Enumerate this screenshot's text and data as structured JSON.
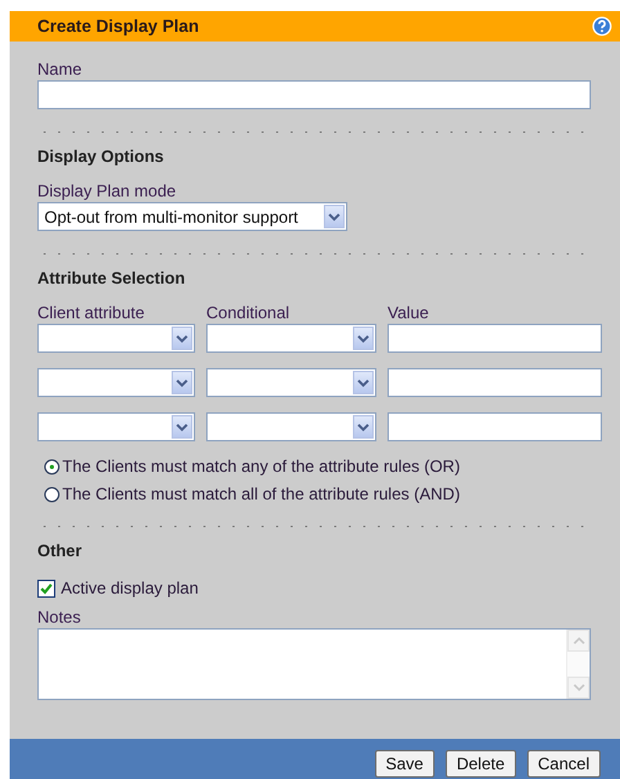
{
  "dialog": {
    "title": "Create Display Plan"
  },
  "name_field": {
    "label": "Name"
  },
  "display_options": {
    "heading": "Display Options",
    "mode_label": "Display Plan mode",
    "mode_value": "Opt-out from multi-monitor support"
  },
  "attribute_selection": {
    "heading": "Attribute Selection",
    "columns": [
      "Client attribute",
      "Conditional",
      "Value"
    ],
    "rows": [
      {},
      {},
      {}
    ],
    "match_options": [
      {
        "label": "The Clients must match any of the attribute rules (OR)",
        "selected": true
      },
      {
        "label": "The Clients must match all of the attribute rules (AND)",
        "selected": false
      }
    ]
  },
  "other": {
    "heading": "Other",
    "active": {
      "label": "Active display plan",
      "checked": true
    },
    "notes_label": "Notes"
  },
  "buttons": [
    "Save",
    "Delete",
    "Cancel"
  ]
}
